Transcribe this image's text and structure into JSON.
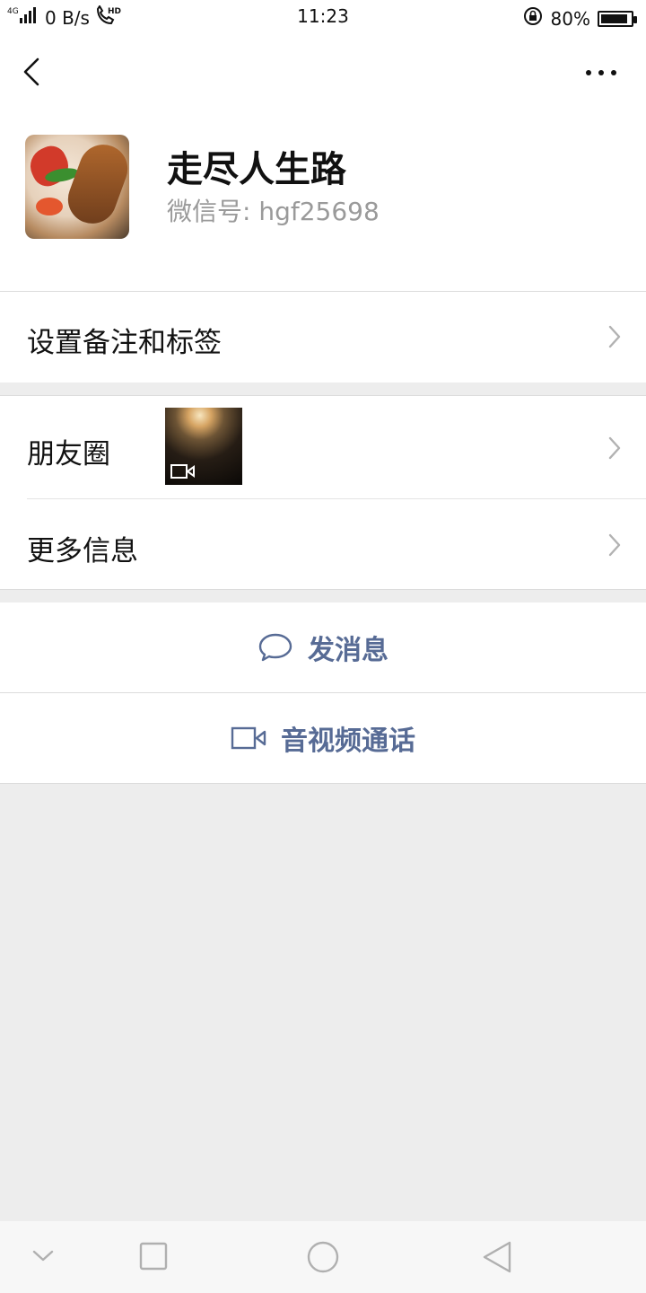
{
  "status_bar": {
    "network": "4G",
    "speed": "0 B/s",
    "call": "HD",
    "time": "11:23",
    "battery": "80%"
  },
  "profile": {
    "name": "走尽人生路",
    "wechat_id": "微信号: hgf25698"
  },
  "rows": {
    "remark_label": "设置备注和标签",
    "moments_label": "朋友圈",
    "more_info_label": "更多信息"
  },
  "actions": {
    "send_message": "发消息",
    "video_call": "音视频通话"
  },
  "colors": {
    "link_blue": "#576b95",
    "background": "#ededed"
  },
  "icons": [
    "back-arrow-icon",
    "more-dots-icon",
    "chevron-right-icon",
    "video-icon",
    "chat-bubble-icon",
    "video-camera-icon"
  ]
}
